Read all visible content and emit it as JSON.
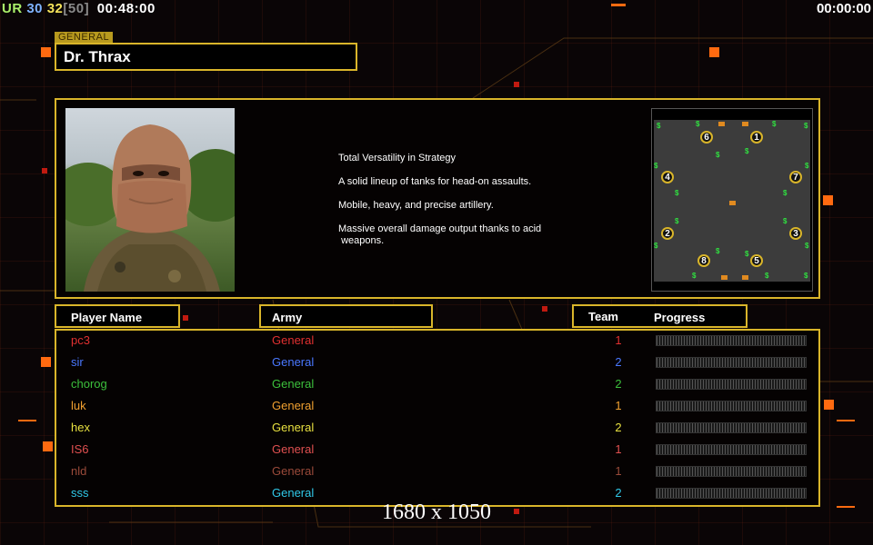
{
  "topbar": {
    "left": {
      "ur": "UR",
      "a": "30",
      "b": "32",
      "c": "[50]",
      "time": "00:48:00"
    },
    "right_time": "00:00:00"
  },
  "general": {
    "label": "GENERAL",
    "name": "Dr. Thrax",
    "description": [
      "Total Versatility in Strategy",
      "A solid lineup of tanks for head-on assaults.",
      "Mobile, heavy, and precise artillery.",
      "Massive overall damage output thanks to acid\n weapons."
    ]
  },
  "map": {
    "spawns": [
      "6",
      "1",
      "4",
      "7",
      "2",
      "3",
      "8",
      "5"
    ]
  },
  "headers": {
    "player_name": "Player Name",
    "army": "Army",
    "team": "Team",
    "progress": "Progress"
  },
  "players": [
    {
      "name": "pc3",
      "army": "General",
      "team": "1",
      "color": "#e03030",
      "progress": 0
    },
    {
      "name": "sir",
      "army": "General",
      "team": "2",
      "color": "#4a78ff",
      "progress": 0
    },
    {
      "name": "chorog",
      "army": "General",
      "team": "2",
      "color": "#3cc03c",
      "progress": 0
    },
    {
      "name": "luk",
      "army": "General",
      "team": "1",
      "color": "#f0a030",
      "progress": 0
    },
    {
      "name": "hex",
      "army": "General",
      "team": "2",
      "color": "#e8e040",
      "progress": 0
    },
    {
      "name": "IS6",
      "army": "General",
      "team": "1",
      "color": "#e05050",
      "progress": 0
    },
    {
      "name": "nld",
      "army": "General",
      "team": "1",
      "color": "#9a4a3a",
      "progress": 0
    },
    {
      "name": "sss",
      "army": "General",
      "team": "2",
      "color": "#30c8e8",
      "progress": 0
    }
  ],
  "resolution_label": "1680 x 1050",
  "colors": {
    "frame": "#d9b52a",
    "accent": "#ff6a10",
    "background": "#0a0506"
  }
}
